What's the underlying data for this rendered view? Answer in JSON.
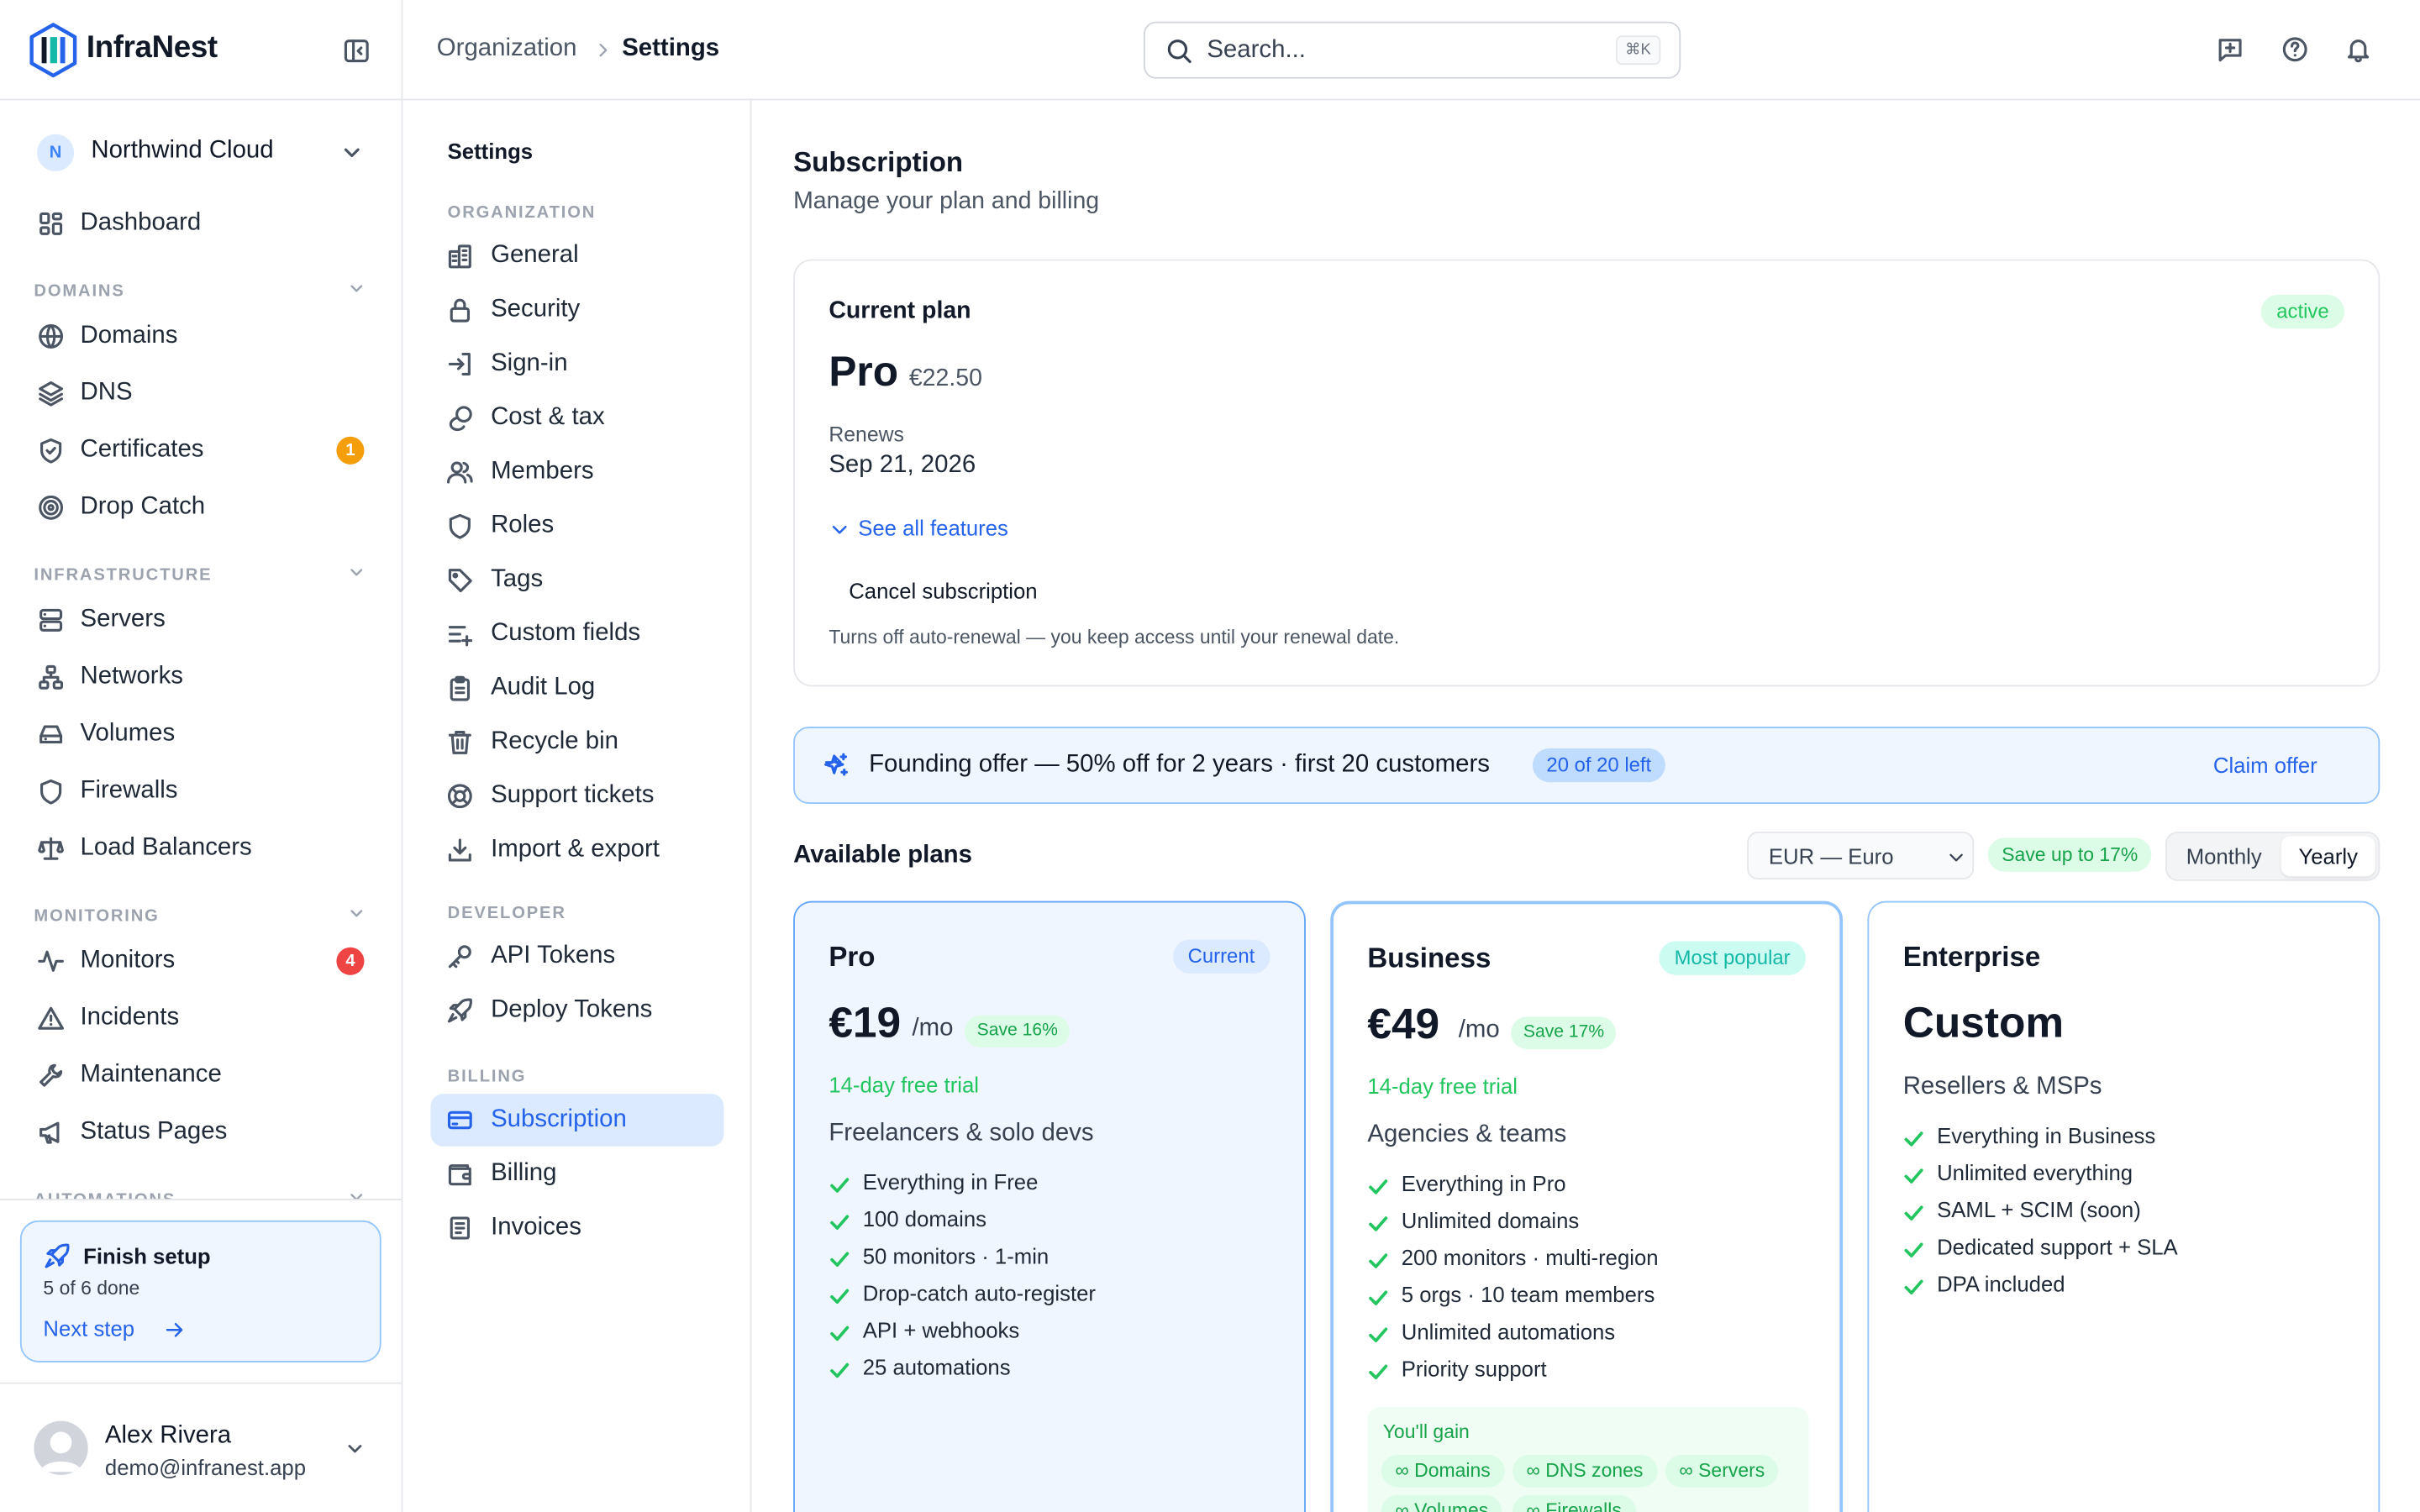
{
  "app": {
    "name": "InfraNest"
  },
  "org": {
    "initial": "N",
    "name": "Northwind Cloud"
  },
  "sidebar": {
    "dashboard": "Dashboard",
    "sections": {
      "domains": "DOMAINS",
      "infrastructure": "INFRASTRUCTURE",
      "monitoring": "MONITORING",
      "automations": "AUTOMATIONS"
    },
    "items": {
      "domains": "Domains",
      "dns": "DNS",
      "certificates": "Certificates",
      "drop_catch": "Drop Catch",
      "servers": "Servers",
      "networks": "Networks",
      "volumes": "Volumes",
      "firewalls": "Firewalls",
      "load_balancers": "Load Balancers",
      "monitors": "Monitors",
      "incidents": "Incidents",
      "maintenance": "Maintenance",
      "status_pages": "Status Pages"
    },
    "badges": {
      "certificates": "1",
      "monitors": "4"
    },
    "badge_colors": {
      "certificates": "#f59e0b",
      "monitors": "#ef4444"
    }
  },
  "setup": {
    "title": "Finish setup",
    "progress": "5 of 6 done",
    "next": "Next step"
  },
  "user": {
    "name": "Alex Rivera",
    "email": "demo@infranest.app"
  },
  "header": {
    "breadcrumb": [
      "Organization",
      "Settings"
    ],
    "search_placeholder": "Search...",
    "shortcut": "⌘K",
    "icons": [
      "feedback-icon",
      "help-icon",
      "bell-icon"
    ]
  },
  "settings_nav": {
    "title": "Settings",
    "organization_label": "ORGANIZATION",
    "organization": [
      "General",
      "Security",
      "Sign-in",
      "Cost & tax",
      "Members",
      "Roles",
      "Tags",
      "Custom fields",
      "Audit Log",
      "Recycle bin",
      "Support tickets",
      "Import & export"
    ],
    "developer_label": "DEVELOPER",
    "developer": [
      "API Tokens",
      "Deploy Tokens"
    ],
    "billing_label": "BILLING",
    "billing": [
      "Subscription",
      "Billing",
      "Invoices"
    ],
    "active": "Subscription"
  },
  "page": {
    "title": "Subscription",
    "subtitle": "Manage your plan and billing"
  },
  "current_plan": {
    "heading": "Current plan",
    "status": "active",
    "plan": "Pro",
    "price": "€22.50",
    "renews_label": "Renews",
    "renews_date": "Sep 21, 2026",
    "see_features": "See all features",
    "cancel": "Cancel subscription",
    "cancel_note": "Turns off auto-renewal — you keep access until your renewal date."
  },
  "offer": {
    "text": "Founding offer — 50% off for 2 years · first 20 customers",
    "badge": "20 of 20 left",
    "cta": "Claim offer"
  },
  "plans_header": {
    "title": "Available plans",
    "currency": "EUR — Euro",
    "save_badge": "Save up to 17%",
    "toggle": [
      "Monthly",
      "Yearly"
    ],
    "selected": "Yearly"
  },
  "plans": [
    {
      "name": "Pro",
      "tag": "Current",
      "price": "€19",
      "per": "/mo",
      "save": "Save 16%",
      "trial": "14-day free trial",
      "desc": "Freelancers & solo devs",
      "features": [
        "Everything in Free",
        "100 domains",
        "50 monitors · 1-min",
        "Drop-catch auto-register",
        "API + webhooks",
        "25 automations"
      ]
    },
    {
      "name": "Business",
      "tag": "Most popular",
      "price": "€49",
      "per": "/mo",
      "save": "Save 17%",
      "trial": "14-day free trial",
      "desc": "Agencies & teams",
      "features": [
        "Everything in Pro",
        "Unlimited domains",
        "200 monitors · multi-region",
        "5 orgs · 10 team members",
        "Unlimited automations",
        "Priority support"
      ],
      "gain_title": "You'll gain",
      "gain": [
        "∞ Domains",
        "∞ DNS zones",
        "∞ Servers",
        "∞ Volumes",
        "∞ Firewalls"
      ]
    },
    {
      "name": "Enterprise",
      "price": "Custom",
      "desc": "Resellers & MSPs",
      "features": [
        "Everything in Business",
        "Unlimited everything",
        "SAML + SCIM (soon)",
        "Dedicated support + SLA",
        "DPA included"
      ]
    }
  ],
  "colors": {
    "accent": "#2563eb",
    "success": "#22c55e",
    "border": "#e5e7eb"
  }
}
